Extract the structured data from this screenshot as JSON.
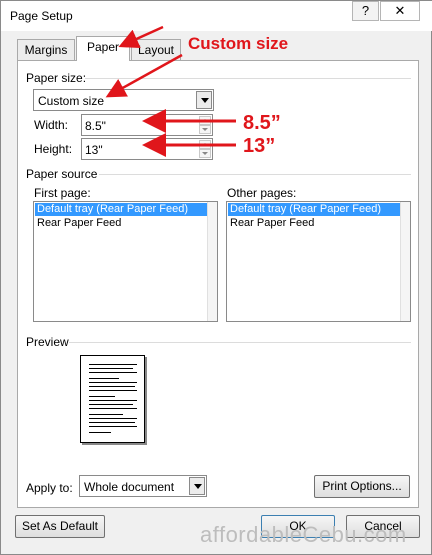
{
  "window": {
    "title": "Page Setup",
    "help_label": "?",
    "close_label": "✕"
  },
  "tabs": [
    {
      "label": "Margins"
    },
    {
      "label": "Paper"
    },
    {
      "label": "Layout"
    }
  ],
  "paper_size": {
    "section_label": "Paper size:",
    "selected": "Custom size",
    "width_label": "Width:",
    "width_value": "8.5\"",
    "height_label": "Height:",
    "height_value": "13\""
  },
  "paper_source": {
    "section_label": "Paper source",
    "first_page_label": "First page:",
    "first_page_items": [
      "Default tray (Rear Paper Feed)",
      "Rear Paper Feed"
    ],
    "other_pages_label": "Other pages:",
    "other_pages_items": [
      "Default tray (Rear Paper Feed)",
      "Rear Paper Feed"
    ]
  },
  "preview": {
    "section_label": "Preview"
  },
  "apply_to": {
    "label": "Apply to:",
    "selected": "Whole document"
  },
  "buttons": {
    "print_options": "Print Options...",
    "set_default": "Set As Default",
    "ok": "OK",
    "cancel": "Cancel"
  },
  "annotations": {
    "custom_size": "Custom size",
    "width": "8.5”",
    "height": "13”",
    "annotation_color": "#e0161b"
  },
  "watermark": "affordableCebu.com"
}
